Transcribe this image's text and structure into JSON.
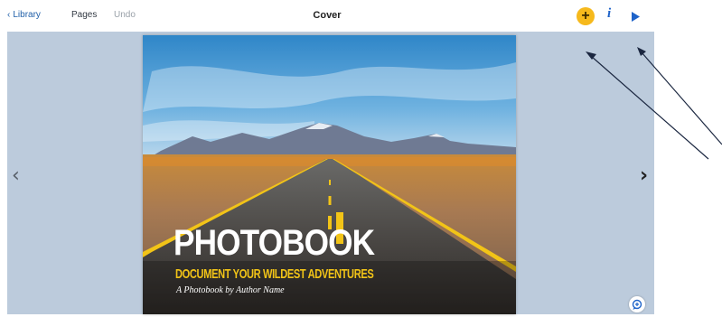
{
  "toolbar": {
    "back_label": "Library",
    "back_icon": "chevron-left-icon",
    "pages_label": "Pages",
    "undo_label": "Undo",
    "title": "Cover",
    "add_icon": "plus-icon",
    "add_symbol": "+",
    "info_icon": "info-icon",
    "info_symbol": "i",
    "play_icon": "play-icon"
  },
  "stage": {
    "prev_icon": "chevron-left-icon",
    "prev_symbol": "‹",
    "next_icon": "chevron-right-icon",
    "next_symbol": "›",
    "comment_icon": "comment-icon"
  },
  "cover": {
    "title": "PHOTOBOOK",
    "subtitle": "DOCUMENT YOUR WILDEST ADVENTURES",
    "author": "A Photobook by Author Name"
  },
  "colors": {
    "accent_yellow": "#f6b91c",
    "accent_blue": "#1e63c9",
    "stage_bg": "#bccbdc"
  }
}
